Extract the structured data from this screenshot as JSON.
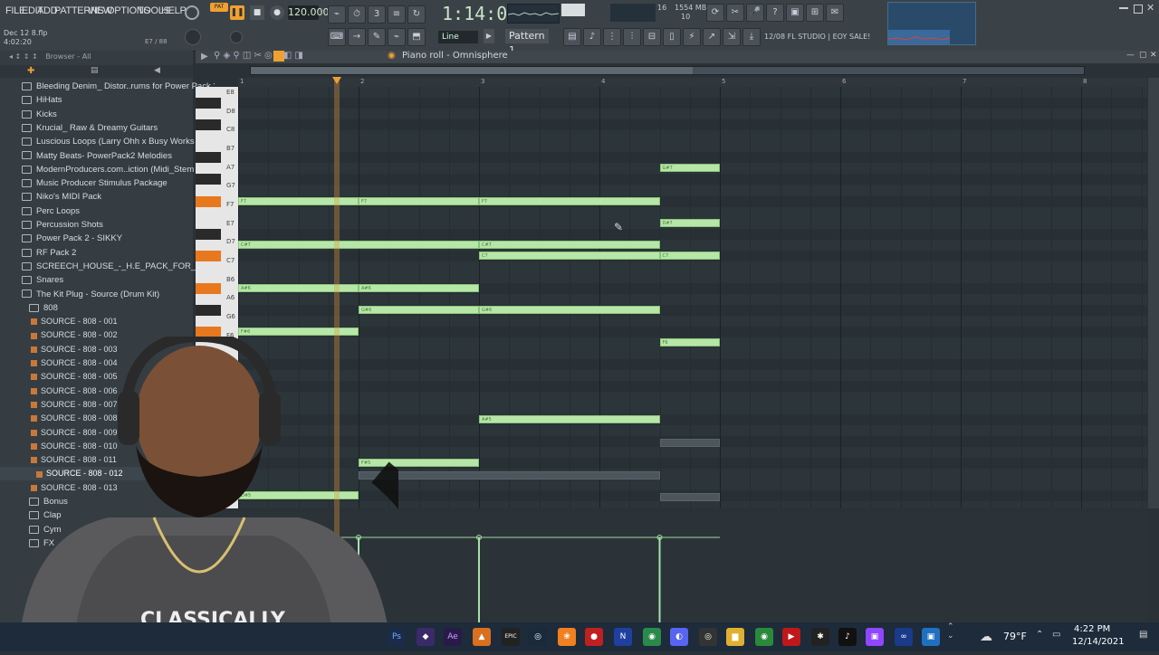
{
  "menu": [
    "FILE",
    "EDIT",
    "ADD",
    "PATTERNS",
    "VIEW",
    "OPTIONS",
    "TOOLS",
    "HELP"
  ],
  "transport": {
    "mode": "PAT",
    "tempo": "120.000",
    "time": "1:14:02",
    "pattern": "Pattern 1",
    "tool": "Line"
  },
  "stats": {
    "cpu": "16",
    "ram": "1554 MB",
    "voices": "10"
  },
  "project": {
    "name": "Dec 12 8.flp",
    "time": "4:02:20",
    "position": "E7 / 88"
  },
  "news": "12/08 FL STUDIO | EOY SALE!",
  "browser": {
    "header": "Browser - All",
    "items": [
      {
        "label": "Bleeding Denim_ Distor..rums for Power Pack 2",
        "type": "folder"
      },
      {
        "label": "HiHats",
        "type": "folder"
      },
      {
        "label": "Kicks",
        "type": "folder"
      },
      {
        "label": "Krucial_ Raw & Dreamy Guitars",
        "type": "folder"
      },
      {
        "label": "Luscious Loops (Larry Ohh x Busy Works Beats)",
        "type": "folder"
      },
      {
        "label": "Matty Beats- PowerPack2 Melodies",
        "type": "folder"
      },
      {
        "label": "ModernProducers.com..iction (Midi_Stem Kit)",
        "type": "folder"
      },
      {
        "label": "Music Producer Stimulus Package",
        "type": "folder"
      },
      {
        "label": "Niko's MIDI Pack",
        "type": "folder"
      },
      {
        "label": "Perc Loops",
        "type": "folder"
      },
      {
        "label": "Percussion Shots",
        "type": "folder"
      },
      {
        "label": "Power Pack 2 - SIKKY",
        "type": "folder"
      },
      {
        "label": "RF Pack 2",
        "type": "folder"
      },
      {
        "label": "SCREECH_HOUSE_-_H.E_PACK_FOR_MEMBERS",
        "type": "folder"
      },
      {
        "label": "Snares",
        "type": "folder"
      },
      {
        "label": "The Kit Plug - Source (Drum Kit)",
        "type": "folder-open"
      },
      {
        "label": "808",
        "type": "subfolder"
      },
      {
        "label": "SOURCE - 808 - 001",
        "type": "file"
      },
      {
        "label": "SOURCE - 808 - 002",
        "type": "file"
      },
      {
        "label": "SOURCE - 808 - 003",
        "type": "file"
      },
      {
        "label": "SOURCE - 808 - 004",
        "type": "file"
      },
      {
        "label": "SOURCE - 808 - 005",
        "type": "file"
      },
      {
        "label": "SOURCE - 808 - 006",
        "type": "file"
      },
      {
        "label": "SOURCE - 808 - 007",
        "type": "file"
      },
      {
        "label": "SOURCE - 808 - 008",
        "type": "file"
      },
      {
        "label": "SOURCE - 808 - 009",
        "type": "file"
      },
      {
        "label": "SOURCE - 808 - 010",
        "type": "file"
      },
      {
        "label": "SOURCE - 808 - 011",
        "type": "file"
      },
      {
        "label": "SOURCE - 808 - 012",
        "type": "file-selected"
      },
      {
        "label": "SOURCE - 808 - 013",
        "type": "file"
      },
      {
        "label": "Bonus",
        "type": "subfolder"
      },
      {
        "label": "Clap",
        "type": "subfolder"
      },
      {
        "label": "Cym",
        "type": "subfolder"
      },
      {
        "label": "FX",
        "type": "subfolder"
      }
    ]
  },
  "piano_roll": {
    "title": "Piano roll - Omnisphere",
    "bar_numbers": [
      "1",
      "2",
      "3",
      "4",
      "5",
      "6",
      "7",
      "8"
    ],
    "key_labels": [
      "E8",
      "D8",
      "C8",
      "B7",
      "A7",
      "G7",
      "F7",
      "E7",
      "D7",
      "C7",
      "B6",
      "A6",
      "G6",
      "F6"
    ],
    "notes": [
      {
        "label": "G#7",
        "bar": 4.5,
        "len": 0.5,
        "row": 7
      },
      {
        "label": "F7",
        "bar": 1,
        "len": 1,
        "row": 10
      },
      {
        "label": "F7",
        "bar": 2,
        "len": 1,
        "row": 10
      },
      {
        "label": "F7",
        "bar": 3,
        "len": 1.5,
        "row": 10
      },
      {
        "label": "D#7",
        "bar": 4.5,
        "len": 0.5,
        "row": 12
      },
      {
        "label": "C#7",
        "bar": 1,
        "len": 2,
        "row": 14
      },
      {
        "label": "C#7",
        "bar": 3,
        "len": 1.5,
        "row": 14
      },
      {
        "label": "C7",
        "bar": 3,
        "len": 1.5,
        "row": 15
      },
      {
        "label": "C7",
        "bar": 4.5,
        "len": 0.5,
        "row": 15
      },
      {
        "label": "A#6",
        "bar": 1,
        "len": 1,
        "row": 18
      },
      {
        "label": "A#6",
        "bar": 2,
        "len": 1,
        "row": 18
      },
      {
        "label": "G#6",
        "bar": 2,
        "len": 1,
        "row": 20
      },
      {
        "label": "G#6",
        "bar": 3,
        "len": 1.5,
        "row": 20
      },
      {
        "label": "F#6",
        "bar": 1,
        "len": 1,
        "row": 22
      },
      {
        "label": "F6",
        "bar": 4.5,
        "len": 0.5,
        "row": 23
      },
      {
        "label": "A#5",
        "bar": 3,
        "len": 1.5,
        "row": 30
      },
      {
        "label": "F#5",
        "bar": 2,
        "len": 1,
        "row": 34
      },
      {
        "label": "D#5",
        "bar": 1,
        "len": 1,
        "row": 37
      }
    ]
  },
  "taskbar": {
    "weather": "79°F",
    "time": "4:22 PM",
    "date": "12/14/2021"
  },
  "webcam_shirt_text": "CLASSICALLY"
}
